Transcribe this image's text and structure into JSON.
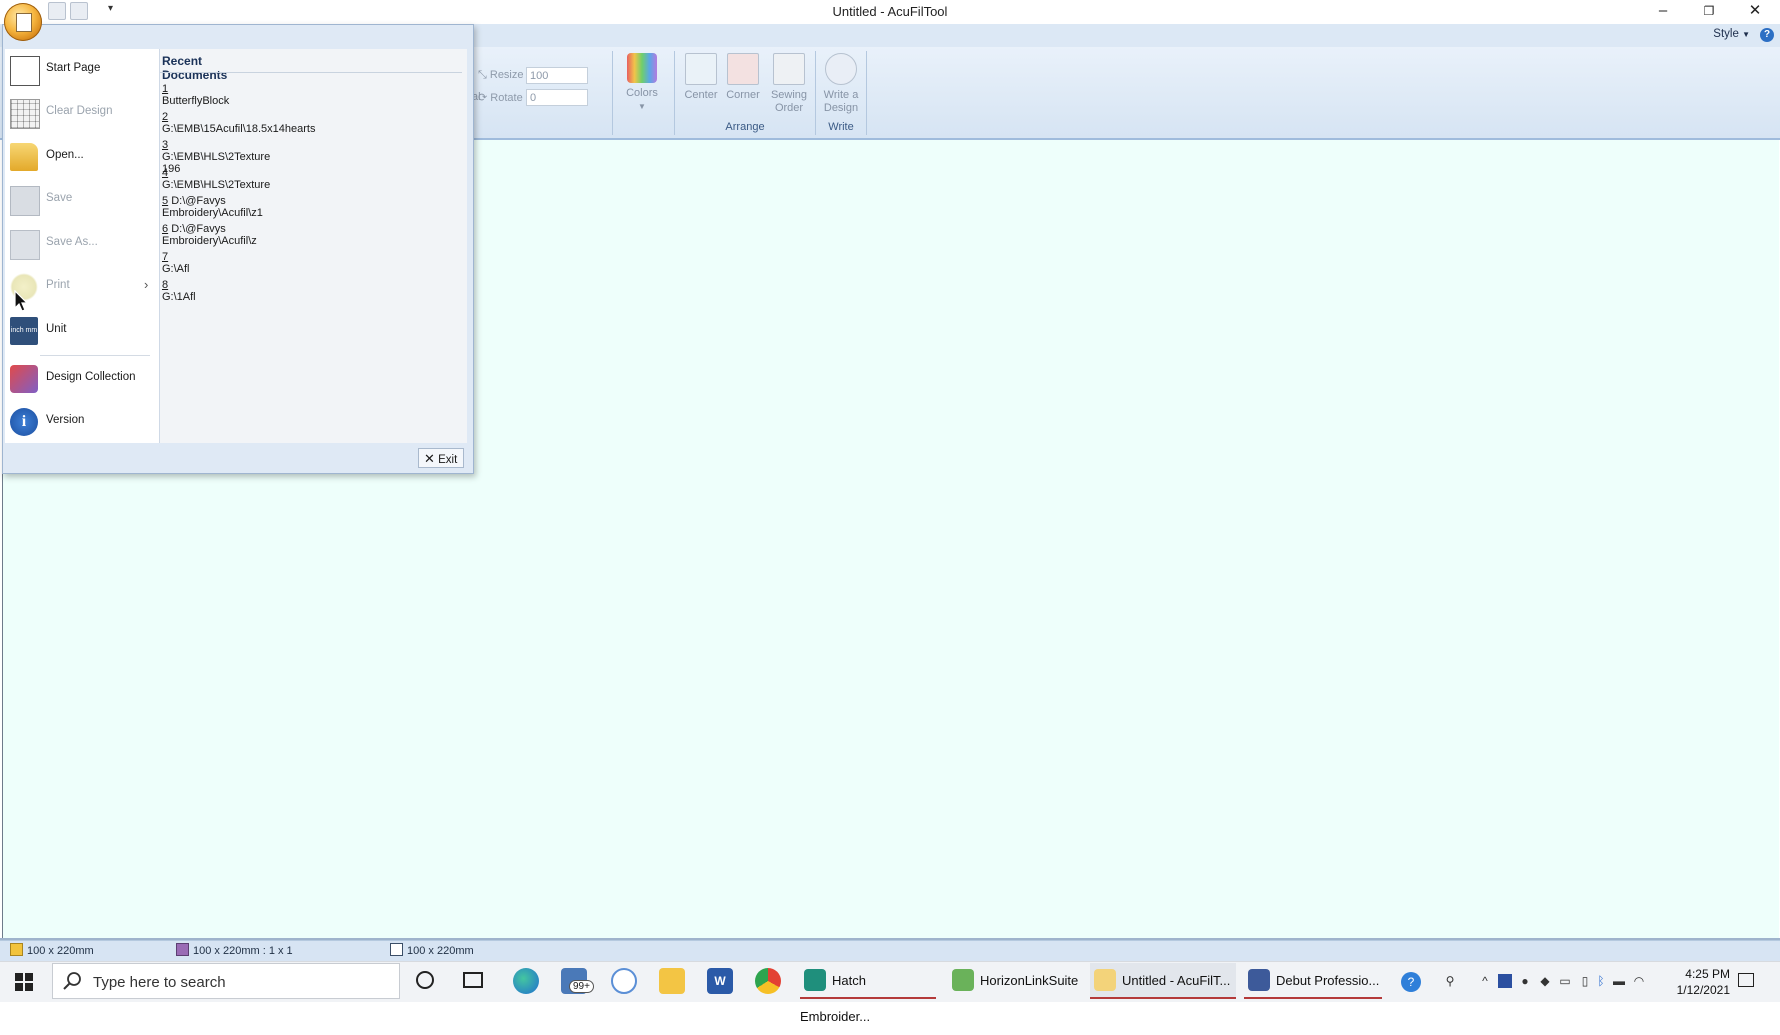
{
  "window": {
    "title": "Untitled - AcuFilTool",
    "minimize": "–",
    "restore": "❐",
    "close": "✕"
  },
  "ribbon": {
    "style_label": "Style",
    "help": "?",
    "resize_label": "Resize",
    "resize_value": "100",
    "rotate_label": "Rotate",
    "rotate_value": "0",
    "partial_label": "al",
    "colors_label": "Colors",
    "center_label": "Center",
    "corner_label": "Corner",
    "sewing_order_label_1": "Sewing",
    "sewing_order_label_2": "Order",
    "write_design_label_1": "Write a",
    "write_design_label_2": "Design",
    "group_arrange": "Arrange",
    "group_write": "Write"
  },
  "app_menu": {
    "items": [
      {
        "label": "Start Page",
        "enabled": true,
        "icon": "start-page-icon"
      },
      {
        "label": "Clear Design",
        "enabled": false,
        "icon": "grid-icon"
      },
      {
        "label": "Open...",
        "enabled": true,
        "icon": "folder-open-icon"
      },
      {
        "label": "Save",
        "enabled": false,
        "icon": "save-icon"
      },
      {
        "label": "Save As...",
        "enabled": false,
        "icon": "save-as-icon"
      },
      {
        "label": "Print",
        "enabled": false,
        "icon": "print-icon"
      },
      {
        "label": "Unit",
        "enabled": true,
        "icon": "unit-icon"
      },
      {
        "label": "Design Collection",
        "enabled": true,
        "icon": "design-collection-icon"
      },
      {
        "label": "Version",
        "enabled": true,
        "icon": "info-icon"
      }
    ],
    "unit_icon_text": "inch mm",
    "print_arrow": "›",
    "recent_title": "Recent Documents",
    "recent": [
      {
        "num": "1",
        "path": "ButterflyBlock"
      },
      {
        "num": "2",
        "path": "G:\\EMB\\15Acufil\\18.5x14hearts"
      },
      {
        "num": "3",
        "path": "G:\\EMB\\HLS\\2Texture 196"
      },
      {
        "num": "4",
        "path": "G:\\EMB\\HLS\\2Texture"
      },
      {
        "num": "5",
        "path": "D:\\@Favys Embroidery\\Acufil\\z1"
      },
      {
        "num": "6",
        "path": "D:\\@Favys Embroidery\\Acufil\\z"
      },
      {
        "num": "7",
        "path": "G:\\Afl"
      },
      {
        "num": "8",
        "path": "G:\\1Afl"
      }
    ],
    "exit_label": "Exit"
  },
  "status": {
    "hoop": "100 x 220mm",
    "grid": "100 x 220mm : 1 x 1",
    "design": "100 x 220mm"
  },
  "taskbar": {
    "search_placeholder": "Type here to search",
    "mail_badge": "99+",
    "apps": [
      {
        "label": "Hatch Embroider..."
      },
      {
        "label": "HorizonLinkSuite"
      },
      {
        "label": "Untitled - AcuFilT..."
      },
      {
        "label": "Debut Professio..."
      }
    ],
    "time": "4:25 PM",
    "date": "1/12/2021"
  }
}
